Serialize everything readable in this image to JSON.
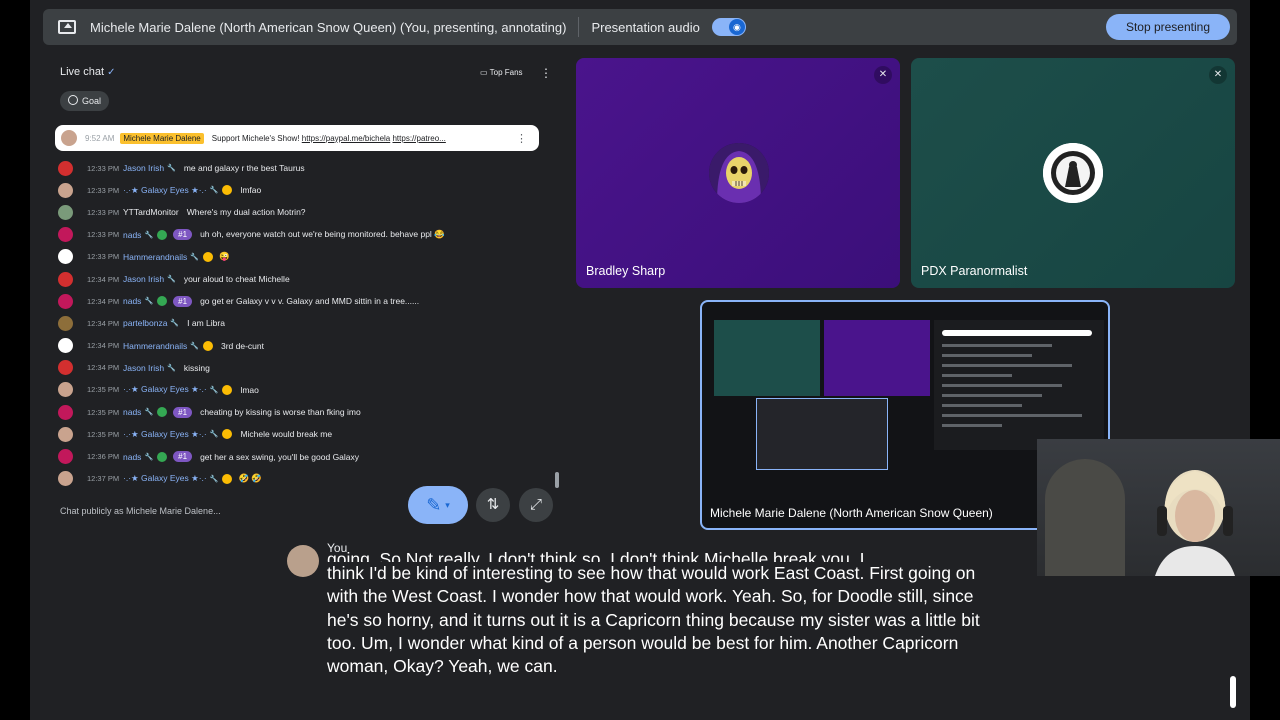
{
  "topbar": {
    "presenter_title": "Michele Marie Dalene (North American Snow Queen) (You, presenting, annotating)",
    "audio_label": "Presentation audio",
    "stop_label": "Stop presenting"
  },
  "chat": {
    "title": "Live chat",
    "top_fans": "Top Fans",
    "goal_label": "Goal",
    "pinned": {
      "time": "9:52 AM",
      "author": "Michele Marie Dalene",
      "message_prefix": "Support Michele's Show! ",
      "link1": "https://paypal.me/bichela",
      "link2": "https://patreo..."
    },
    "messages": [
      {
        "time": "12:33 PM",
        "name": "Jason Irish",
        "text": "me and galaxy r the best Taurus",
        "avatar_color": "#d32f2f",
        "rank": "",
        "badge": "",
        "emoji": ""
      },
      {
        "time": "12:33 PM",
        "name": "·.·★ Galaxy Eyes ★·.·",
        "text": "lmfao",
        "avatar_color": "#c9a38e",
        "rank": "",
        "badge": "gold",
        "emoji": ""
      },
      {
        "time": "12:33 PM",
        "name": "YTTardMonitor",
        "text": "Where's my dual action Motrin?",
        "avatar_color": "#7a9a7a",
        "rank": "",
        "badge": "",
        "emoji": "",
        "plain": true
      },
      {
        "time": "12:33 PM",
        "name": "nads",
        "text": "uh oh, everyone watch out we're being monitored. behave ppl 😂",
        "avatar_color": "#c2185b",
        "rank": "#1",
        "badge": "green",
        "emoji": ""
      },
      {
        "time": "12:33 PM",
        "name": "Hammerandnails",
        "text": "",
        "avatar_color": "#ffffff",
        "rank": "",
        "badge": "gold",
        "emoji": "😜"
      },
      {
        "time": "12:34 PM",
        "name": "Jason Irish",
        "text": "your aloud to cheat Michelle",
        "avatar_color": "#d32f2f",
        "rank": "",
        "badge": "",
        "emoji": ""
      },
      {
        "time": "12:34 PM",
        "name": "nads",
        "text": "go get er Galaxy v v v. Galaxy and MMD sittin in a tree......",
        "avatar_color": "#c2185b",
        "rank": "#1",
        "badge": "green",
        "emoji": ""
      },
      {
        "time": "12:34 PM",
        "name": "partelbonza",
        "text": "I am Libra",
        "avatar_color": "#8d6e3a",
        "rank": "",
        "badge": "",
        "emoji": ""
      },
      {
        "time": "12:34 PM",
        "name": "Hammerandnails",
        "text": "3rd de-cunt",
        "avatar_color": "#ffffff",
        "rank": "",
        "badge": "gold",
        "emoji": ""
      },
      {
        "time": "12:34 PM",
        "name": "Jason Irish",
        "text": "kissing",
        "avatar_color": "#d32f2f",
        "rank": "",
        "badge": "",
        "emoji": ""
      },
      {
        "time": "12:35 PM",
        "name": "·.·★ Galaxy Eyes ★·.·",
        "text": "lmao",
        "avatar_color": "#c9a38e",
        "rank": "",
        "badge": "gold",
        "emoji": ""
      },
      {
        "time": "12:35 PM",
        "name": "nads",
        "text": "cheating by kissing is worse than fking imo",
        "avatar_color": "#c2185b",
        "rank": "#1",
        "badge": "green",
        "emoji": ""
      },
      {
        "time": "12:35 PM",
        "name": "·.·★ Galaxy Eyes ★·.·",
        "text": "Michele would break me",
        "avatar_color": "#c9a38e",
        "rank": "",
        "badge": "gold",
        "emoji": ""
      },
      {
        "time": "12:36 PM",
        "name": "nads",
        "text": "get her a sex swing, you'll be good Galaxy",
        "avatar_color": "#c2185b",
        "rank": "#1",
        "badge": "green",
        "emoji": ""
      },
      {
        "time": "12:37 PM",
        "name": "·.·★ Galaxy Eyes ★·.·",
        "text": "",
        "avatar_color": "#c9a38e",
        "rank": "",
        "badge": "gold",
        "emoji": "🤣 🤣"
      }
    ],
    "input_placeholder": "Chat publicly as Michele Marie Dalene..."
  },
  "participants": {
    "bradley": "Bradley Sharp",
    "pdx": "PDX Paranormalist"
  },
  "share": {
    "name": "Michele Marie Dalene (North American Snow Queen)"
  },
  "captions": {
    "speaker": "You",
    "cut_line": "going. So Not really, I don't think so, I don't think Michelle break you. I",
    "text": "think I'd be kind of interesting to see how that would work East Coast. First going on with the West Coast. I wonder how that would work. Yeah. So, for Doodle still, since he's so horny, and it turns out it is a Capricorn thing because my sister was a little bit too. Um, I wonder what kind of a person would be best for him. Another Capricorn woman, Okay? Yeah, we can."
  },
  "colors": {
    "accent": "#8ab4f8",
    "surface": "#202124",
    "bar": "#3c4043"
  }
}
